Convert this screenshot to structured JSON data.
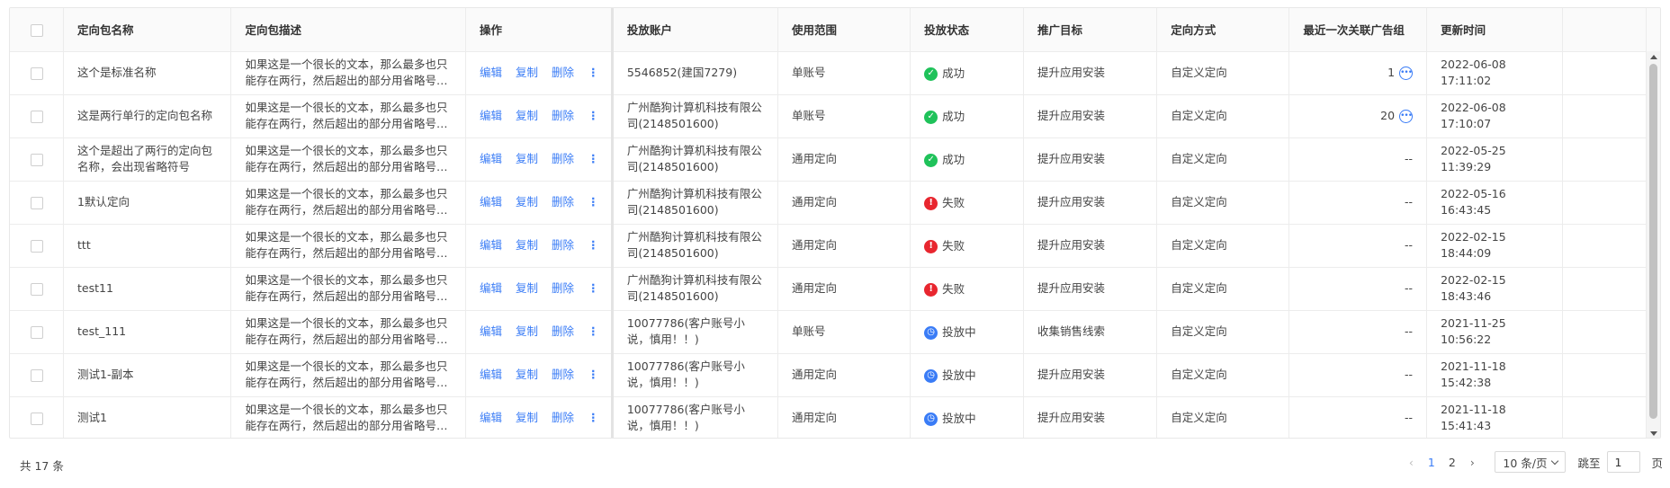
{
  "table": {
    "columns": [
      "定向包名称",
      "定向包描述",
      "操作",
      "投放账户",
      "使用范围",
      "投放状态",
      "推广目标",
      "定向方式",
      "最近一次关联广告组",
      "更新时间"
    ],
    "actions": {
      "edit": "编辑",
      "copy": "复制",
      "delete": "删除"
    },
    "rows": [
      {
        "name": "这个是标准名称",
        "desc": "如果这是一个很长的文本，那么最多也只能存在两行，然后超出的部分用省略号显示，当鼠标悬停时展示全部内容",
        "account": "5546852(建国7279)",
        "scope": "单账号",
        "status": "成功",
        "status_type": "ok",
        "goal": "提升应用安装",
        "method": "自定义定向",
        "adgroup": "1",
        "updated": "2022-06-08 17:11:02"
      },
      {
        "name": "这是两行单行的定向包名称",
        "desc": "如果这是一个很长的文本，那么最多也只能存在两行，然后超出的部分用省略号显示，当鼠标悬停时展示全部内容",
        "account": "广州酷狗计算机科技有限公司(2148501600)",
        "scope": "单账号",
        "status": "成功",
        "status_type": "ok",
        "goal": "提升应用安装",
        "method": "自定义定向",
        "adgroup": "20",
        "updated": "2022-06-08 17:10:07"
      },
      {
        "name": "这个是超出了两行的定向包名称，会出现省略符号",
        "desc": "如果这是一个很长的文本，那么最多也只能存在两行，然后超出的部分用省略号显示，当鼠标悬停时展示全部内容",
        "account": "广州酷狗计算机科技有限公司(2148501600)",
        "scope": "通用定向",
        "status": "成功",
        "status_type": "ok",
        "goal": "提升应用安装",
        "method": "自定义定向",
        "adgroup": "--",
        "updated": "2022-05-25 11:39:29"
      },
      {
        "name": "1默认定向",
        "desc": "如果这是一个很长的文本，那么最多也只能存在两行，然后超出的部分用省略号显示，当鼠标悬停时展示全部内容",
        "account": "广州酷狗计算机科技有限公司(2148501600)",
        "scope": "通用定向",
        "status": "失败",
        "status_type": "err",
        "goal": "提升应用安装",
        "method": "自定义定向",
        "adgroup": "--",
        "updated": "2022-05-16 16:43:45"
      },
      {
        "name": "ttt",
        "desc": "如果这是一个很长的文本，那么最多也只能存在两行，然后超出的部分用省略号显示，当鼠标悬停时展示全部内容",
        "account": "广州酷狗计算机科技有限公司(2148501600)",
        "scope": "通用定向",
        "status": "失败",
        "status_type": "err",
        "goal": "提升应用安装",
        "method": "自定义定向",
        "adgroup": "--",
        "updated": "2022-02-15 18:44:09"
      },
      {
        "name": "test11",
        "desc": "如果这是一个很长的文本，那么最多也只能存在两行，然后超出的部分用省略号显示，当鼠标悬停时展示全部内容",
        "account": "广州酷狗计算机科技有限公司(2148501600)",
        "scope": "通用定向",
        "status": "失败",
        "status_type": "err",
        "goal": "提升应用安装",
        "method": "自定义定向",
        "adgroup": "--",
        "updated": "2022-02-15 18:43:46"
      },
      {
        "name": "test_111",
        "desc": "如果这是一个很长的文本，那么最多也只能存在两行，然后超出的部分用省略号显示，当鼠标悬停时展示全部内容",
        "account": "10077786(客户账号小说，慎用！！)",
        "scope": "单账号",
        "status": "投放中",
        "status_type": "run",
        "goal": "收集销售线索",
        "method": "自定义定向",
        "adgroup": "--",
        "updated": "2021-11-25 10:56:22"
      },
      {
        "name": "测试1-副本",
        "desc": "如果这是一个很长的文本，那么最多也只能存在两行，然后超出的部分用省略号显示，当鼠标悬停时展示全部内容",
        "account": "10077786(客户账号小说，慎用！！)",
        "scope": "通用定向",
        "status": "投放中",
        "status_type": "run",
        "goal": "提升应用安装",
        "method": "自定义定向",
        "adgroup": "--",
        "updated": "2021-11-18 15:42:38"
      },
      {
        "name": "测试1",
        "desc": "如果这是一个很长的文本，那么最多也只能存在两行，然后超出的部分用省略号显示，当鼠标悬停时展示全部内容",
        "account": "10077786(客户账号小说，慎用！！)",
        "scope": "通用定向",
        "status": "投放中",
        "status_type": "run",
        "goal": "提升应用安装",
        "method": "自定义定向",
        "adgroup": "--",
        "updated": "2021-11-18 15:41:43"
      }
    ]
  },
  "footer": {
    "total": "共 17 条",
    "pages": [
      "1",
      "2"
    ],
    "current_page": "1",
    "page_size": "10 条/页",
    "jump_label": "跳至",
    "jump_value": "1",
    "page_suffix": "页"
  },
  "colors": {
    "accent": "#3a7cf6",
    "success": "#1fc25a",
    "error": "#e8262f",
    "running": "#3a7cf6"
  },
  "icons": {
    "ok": "check-circle-icon",
    "err": "exclamation-circle-icon",
    "run": "clock-icon",
    "more": "more-vertical-icon",
    "ellipsis": "ellipsis-circle-icon"
  }
}
